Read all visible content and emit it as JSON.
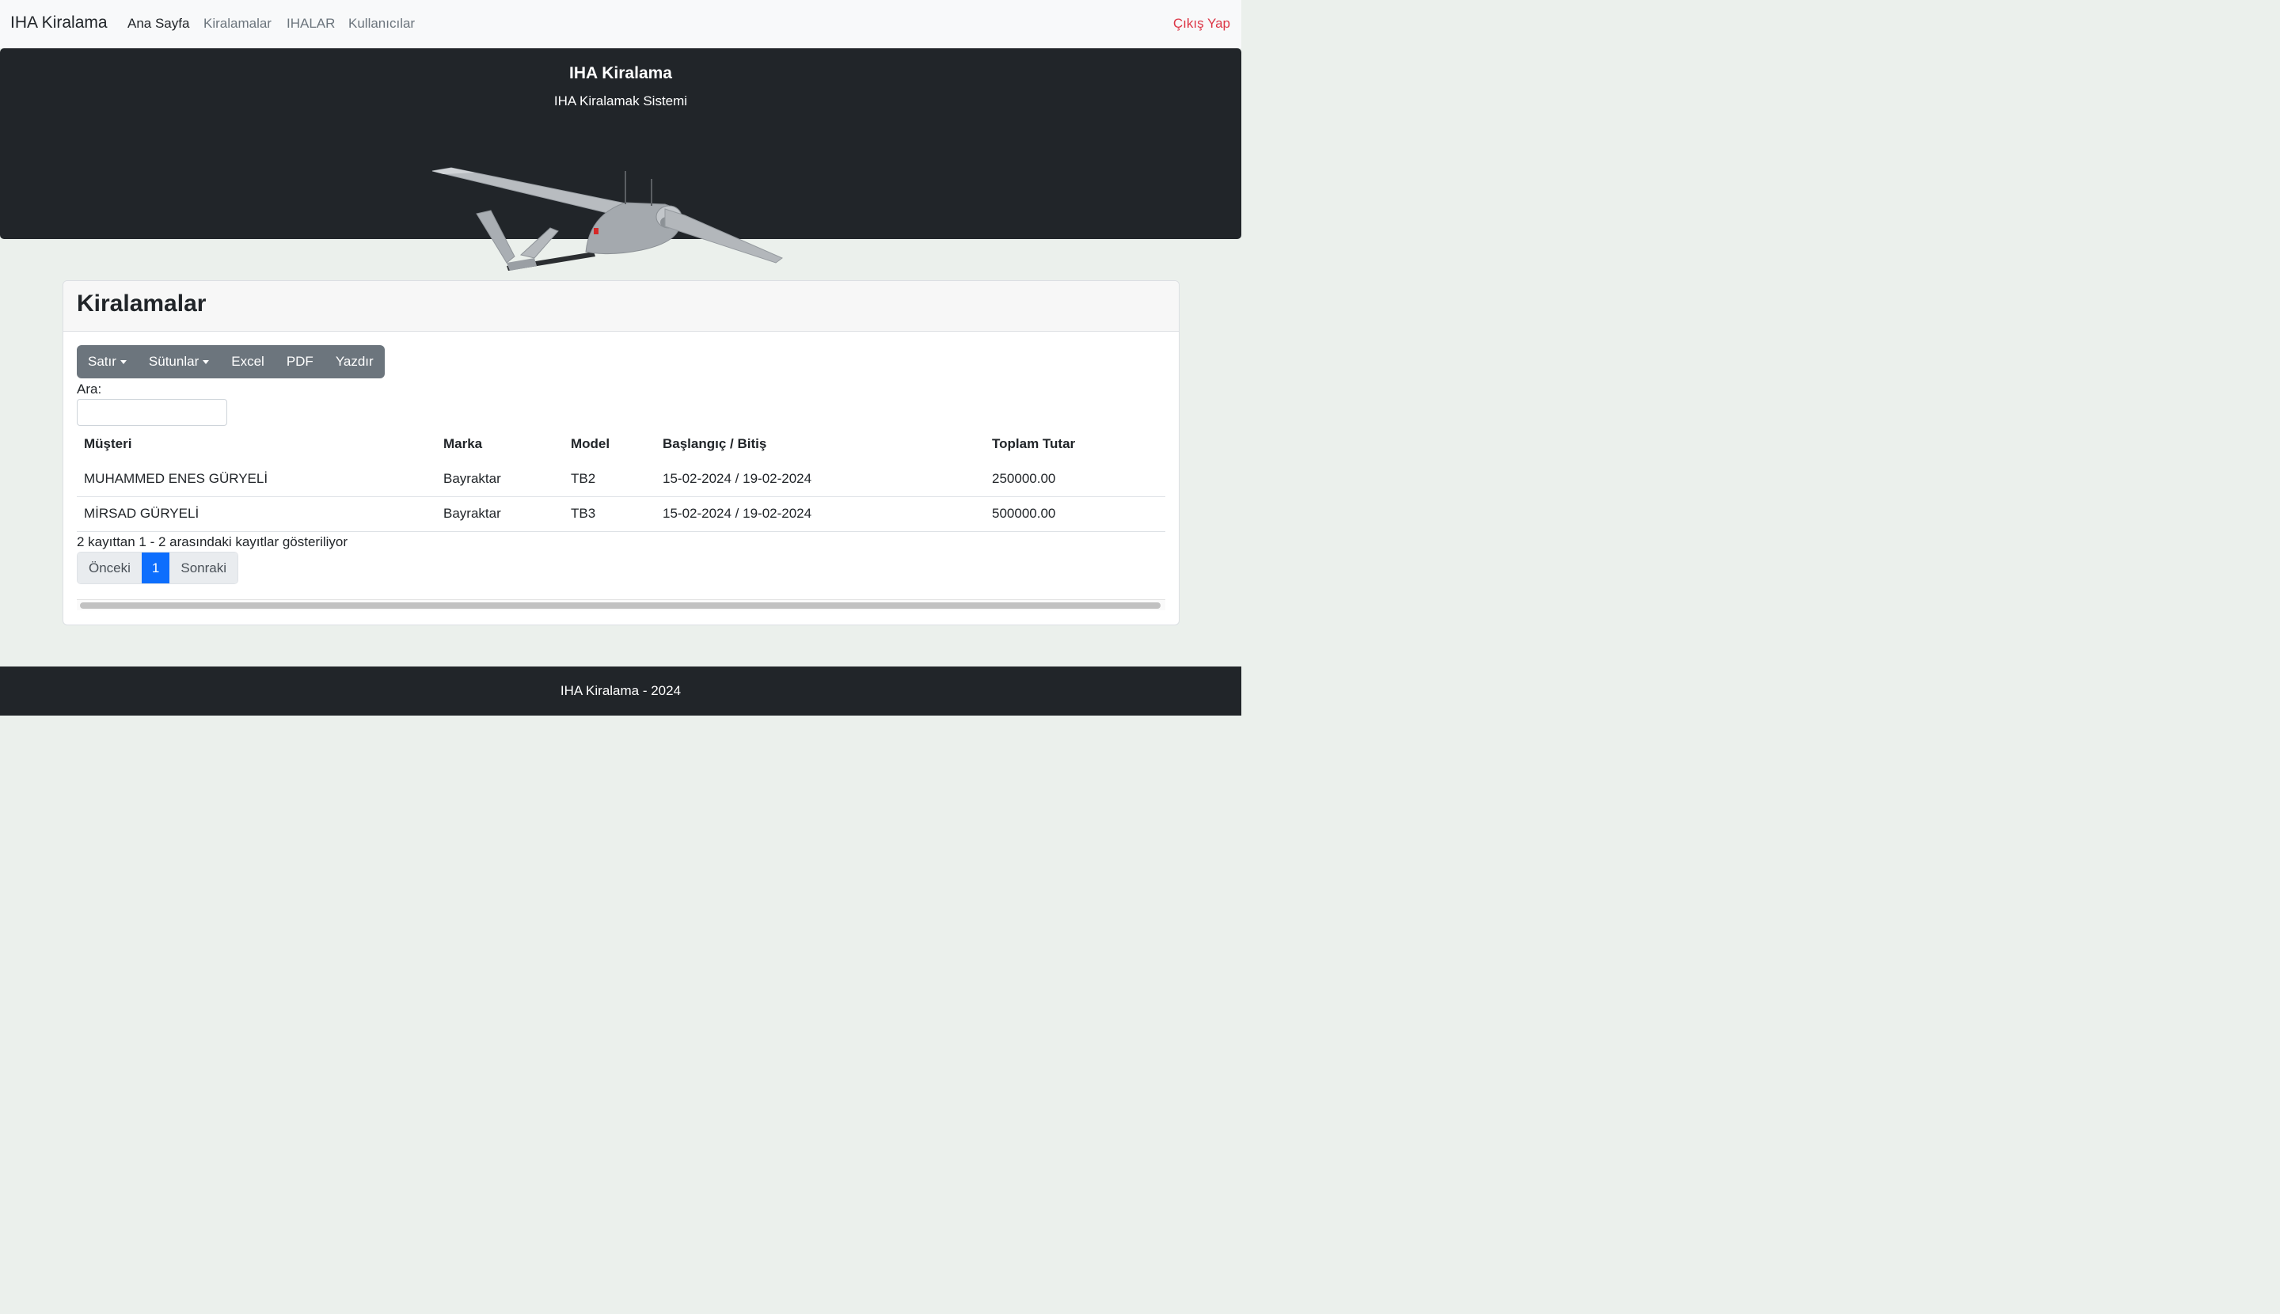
{
  "navbar": {
    "brand": "IHA Kiralama",
    "links": [
      "Ana Sayfa",
      "Kiralamalar",
      "IHALAR",
      "Kullanıcılar"
    ],
    "logout": "Çıkış Yap"
  },
  "hero": {
    "title": "IHA Kiralama",
    "subtitle": "IHA Kiralamak Sistemi",
    "image": "drone-image"
  },
  "card": {
    "title": "Kiralamalar",
    "buttons": [
      "Satır",
      "Sütunlar",
      "Excel",
      "PDF",
      "Yazdır"
    ],
    "search_label": "Ara:",
    "search_value": "",
    "table": {
      "headers": [
        "Müşteri",
        "Marka",
        "Model",
        "Başlangıç / Bitiş",
        "Toplam Tutar"
      ],
      "rows": [
        [
          "MUHAMMED ENES GÜRYELİ",
          "Bayraktar",
          "TB2",
          "15-02-2024 / 19-02-2024",
          "250000.00"
        ],
        [
          "MİRSAD GÜRYELİ",
          "Bayraktar",
          "TB3",
          "15-02-2024 / 19-02-2024",
          "500000.00"
        ]
      ]
    },
    "info": "2 kayıttan 1 - 2 arasındaki kayıtlar gösteriliyor",
    "pagination": {
      "prev": "Önceki",
      "current": "1",
      "next": "Sonraki"
    }
  },
  "footer": {
    "text": "IHA Kiralama - 2024"
  },
  "colors": {
    "primary": "#0d6efd",
    "danger": "#dc3545",
    "dark": "#212529",
    "secondary": "#6c757d"
  }
}
